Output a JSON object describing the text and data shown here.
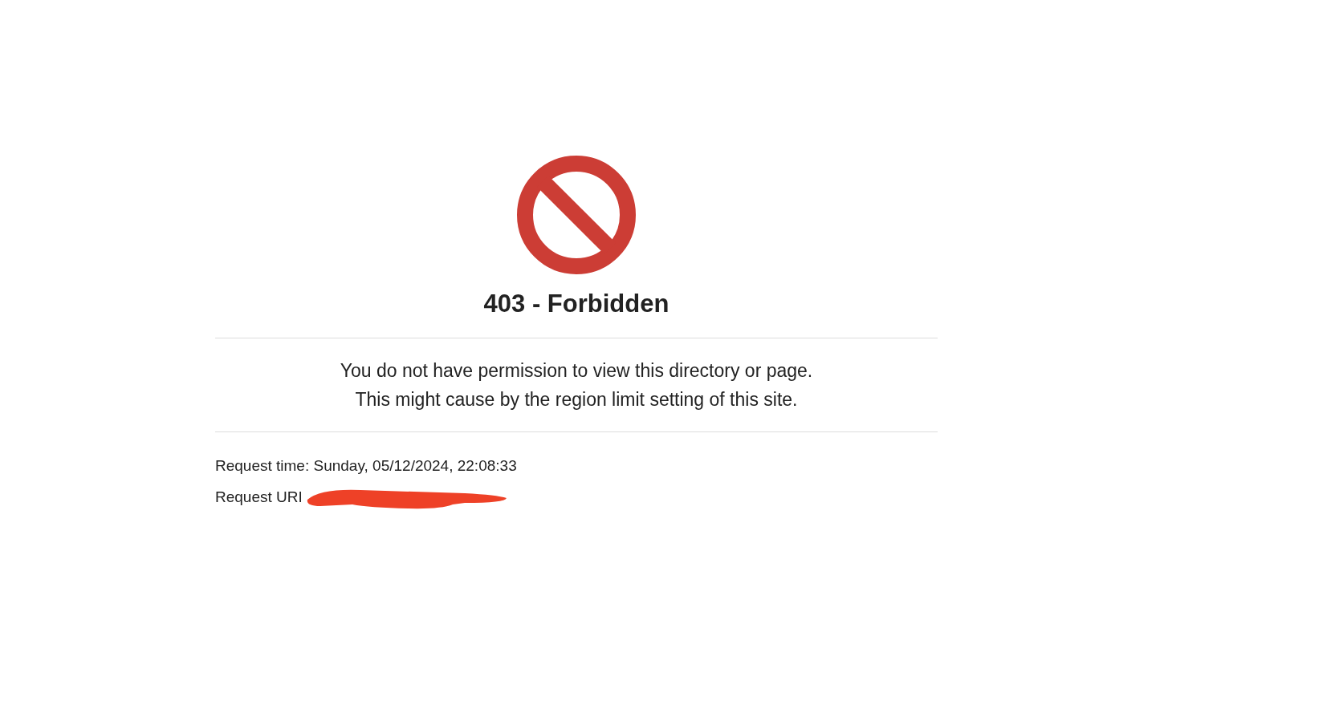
{
  "title": "403 - Forbidden",
  "message": [
    "You do not have permission to view this directory or page.",
    "This might cause by the region limit setting of this site."
  ],
  "details": [
    {
      "kind": "text",
      "label": "Request time: Sunday, 05/12/2024, 22:08:33"
    },
    {
      "kind": "redacted",
      "label": "Request URI"
    }
  ]
}
